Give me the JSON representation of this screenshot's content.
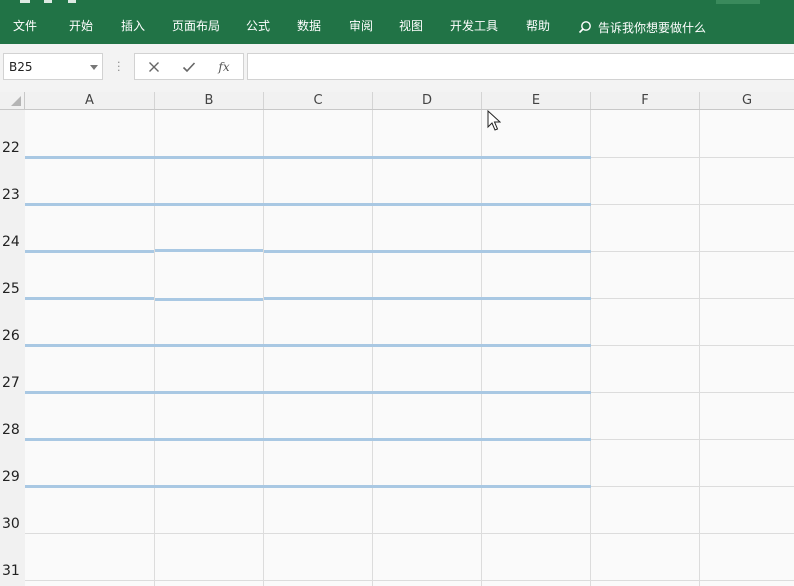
{
  "ribbon": {
    "tabs": [
      "文件",
      "开始",
      "插入",
      "页面布局",
      "公式",
      "数据",
      "审阅",
      "视图",
      "开发工具",
      "帮助"
    ],
    "tell_me": "告诉我你想要做什么",
    "accent_color": "#217346"
  },
  "formula_bar": {
    "name_box": "B25",
    "cancel_icon": "close-icon",
    "enter_icon": "check-icon",
    "fx_label": "fx",
    "formula": ""
  },
  "sheet": {
    "columns": [
      "A",
      "B",
      "C",
      "D",
      "E",
      "F",
      "G"
    ],
    "rows": [
      "22",
      "23",
      "24",
      "25",
      "26",
      "27",
      "28",
      "29",
      "30",
      "31"
    ],
    "border_color": "#a9c8e3"
  }
}
